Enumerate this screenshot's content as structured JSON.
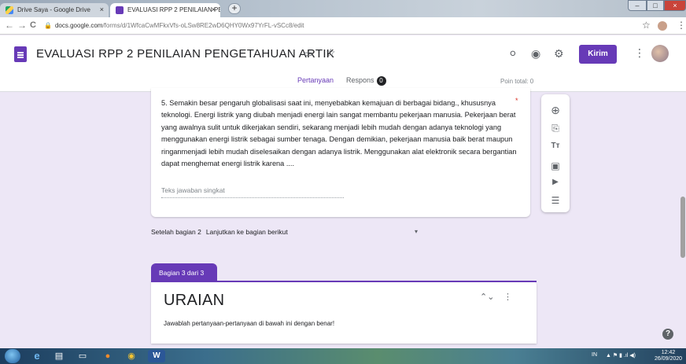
{
  "browser": {
    "tabs": [
      {
        "label": "Drive Saya - Google Drive",
        "active": false,
        "close": "×"
      },
      {
        "label": "EVALUASI RPP 2 PENILAIAN PEN",
        "active": true,
        "close": "×"
      }
    ],
    "new_tab_glyph": "+",
    "window_controls": {
      "minimize": "–",
      "maximize": "□",
      "close": "×"
    },
    "nav": {
      "back": "←",
      "forward": "→",
      "reload": "C"
    },
    "url_host": "docs.google.com",
    "url_path": "/forms/d/1WfcaCwMFkxVfs-oLSw8RE2wD6QHY0Wx97YrFL-vSCc8/edit",
    "lock_glyph": "🔒",
    "bookmark_glyph": "☆",
    "menu_glyph": "⋮"
  },
  "form": {
    "title": "EVALUASI RPP 2 PENILAIAN PENGETAHUAN ARTIK",
    "icons": {
      "folder": "folder-icon",
      "star": "star-icon",
      "palette": "palette-icon",
      "preview": "eye-icon",
      "settings": "gear-icon"
    },
    "send_label": "Kirim",
    "tabs": {
      "questions": "Pertanyaan",
      "responses": "Respons",
      "responses_count": "0"
    },
    "points_total": "Poin total: 0"
  },
  "question": {
    "text": "5.   Semakin besar pengaruh globalisasi saat ini, menyebabkan kemajuan di berbagai bidang., khususnya teknologi. Energi listrik yang diubah menjadi energi lain sangat membantu pekerjaan manusia. Pekerjaan berat yang awalnya sulit untuk dikerjakan sendiri, sekarang menjadi lebih mudah dengan adanya teknologi yang menggunakan energi listrik sebagai sumber tenaga. Dengan demikian, pekerjaan manusia baik berat maupun ringanmenjadi lebih mudah diselesaikan dengan adanya listrik. Menggunakan alat elektronik secara bergantian dapat menghemat energi listrik karena ....",
    "required_mark": "*",
    "answer_placeholder": "Teks jawaban singkat"
  },
  "toolbar": {
    "icons": [
      "add-question-icon",
      "import-questions-icon",
      "add-title-icon",
      "add-image-icon",
      "add-video-icon",
      "add-section-icon"
    ],
    "glyphs": [
      "⊕",
      "⎘",
      "Tт",
      "▣",
      "▶",
      "☰"
    ]
  },
  "after_section": {
    "label": "Setelah bagian 2",
    "value": "Lanjutkan ke bagian berikut",
    "caret": "▾"
  },
  "section": {
    "label": "Bagian 3 dari 3",
    "title": "URAIAN",
    "description": "Jawablah pertanyaan-pertanyaan di bawah ini dengan benar!",
    "collapse_glyph": "⌃",
    "more_glyph": "⋮"
  },
  "help_glyph": "?",
  "taskbar": {
    "apps": [
      "ie-icon",
      "explorer-icon",
      "folder-icon",
      "firefox-icon",
      "chrome-icon",
      "word-icon"
    ],
    "app_glyphs": [
      "e",
      "▤",
      "▭",
      "●",
      "◉",
      "W"
    ],
    "tray_lang": "IN",
    "tray_icons": "▲ ⚑ ▮ .ıl ◀)",
    "time": "12:42",
    "date": "26/09/2020"
  },
  "colors": {
    "accent": "#673ab7",
    "background": "#ede7f6",
    "required": "#d93025"
  }
}
